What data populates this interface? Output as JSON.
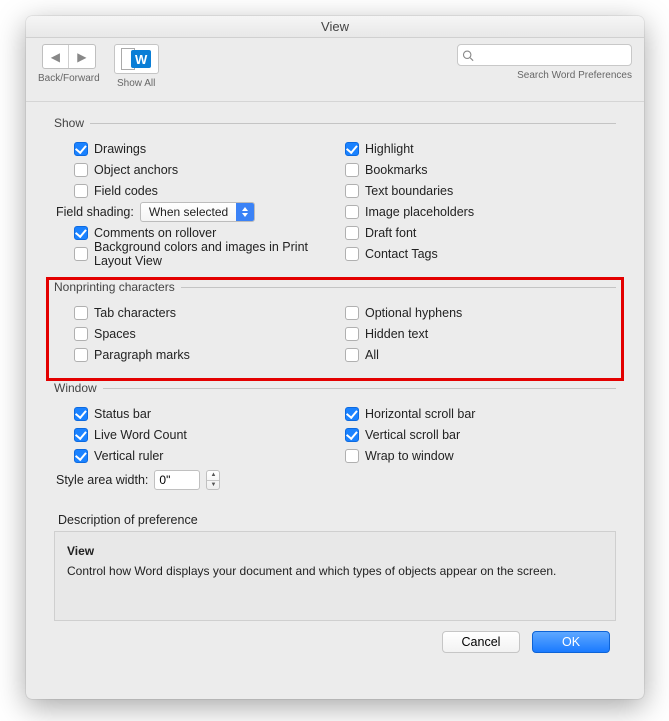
{
  "title": "View",
  "toolbar": {
    "back_forward_label": "Back/Forward",
    "showall_label": "Show All",
    "search_placeholder": "",
    "search_label": "Search Word Preferences"
  },
  "groups": {
    "show": {
      "title": "Show",
      "left": [
        {
          "label": "Drawings",
          "checked": true
        },
        {
          "label": "Object anchors",
          "checked": false
        },
        {
          "label": "Field codes",
          "checked": false
        }
      ],
      "field_shading_label": "Field shading:",
      "field_shading_value": "When selected",
      "left2": [
        {
          "label": "Comments on rollover",
          "checked": true
        },
        {
          "label": "Background colors and images in Print Layout View",
          "checked": false
        }
      ],
      "right": [
        {
          "label": "Highlight",
          "checked": true
        },
        {
          "label": "Bookmarks",
          "checked": false
        },
        {
          "label": "Text boundaries",
          "checked": false
        },
        {
          "label": "Image placeholders",
          "checked": false
        },
        {
          "label": "Draft font",
          "checked": false
        },
        {
          "label": "Contact Tags",
          "checked": false
        }
      ]
    },
    "nonprinting": {
      "title": "Nonprinting characters",
      "left": [
        {
          "label": "Tab characters",
          "checked": false
        },
        {
          "label": "Spaces",
          "checked": false
        },
        {
          "label": "Paragraph marks",
          "checked": false
        }
      ],
      "right": [
        {
          "label": "Optional hyphens",
          "checked": false
        },
        {
          "label": "Hidden text",
          "checked": false
        },
        {
          "label": "All",
          "checked": false
        }
      ]
    },
    "window": {
      "title": "Window",
      "left": [
        {
          "label": "Status bar",
          "checked": true
        },
        {
          "label": "Live Word Count",
          "checked": true
        },
        {
          "label": "Vertical ruler",
          "checked": true
        }
      ],
      "style_area_label": "Style area width:",
      "style_area_value": "0\"",
      "right": [
        {
          "label": "Horizontal scroll bar",
          "checked": true
        },
        {
          "label": "Vertical scroll bar",
          "checked": true
        },
        {
          "label": "Wrap to window",
          "checked": false
        }
      ]
    }
  },
  "description": {
    "heading": "Description of preference",
    "title": "View",
    "body": "Control how Word displays your document and which types of objects appear on the screen."
  },
  "buttons": {
    "cancel": "Cancel",
    "ok": "OK"
  }
}
